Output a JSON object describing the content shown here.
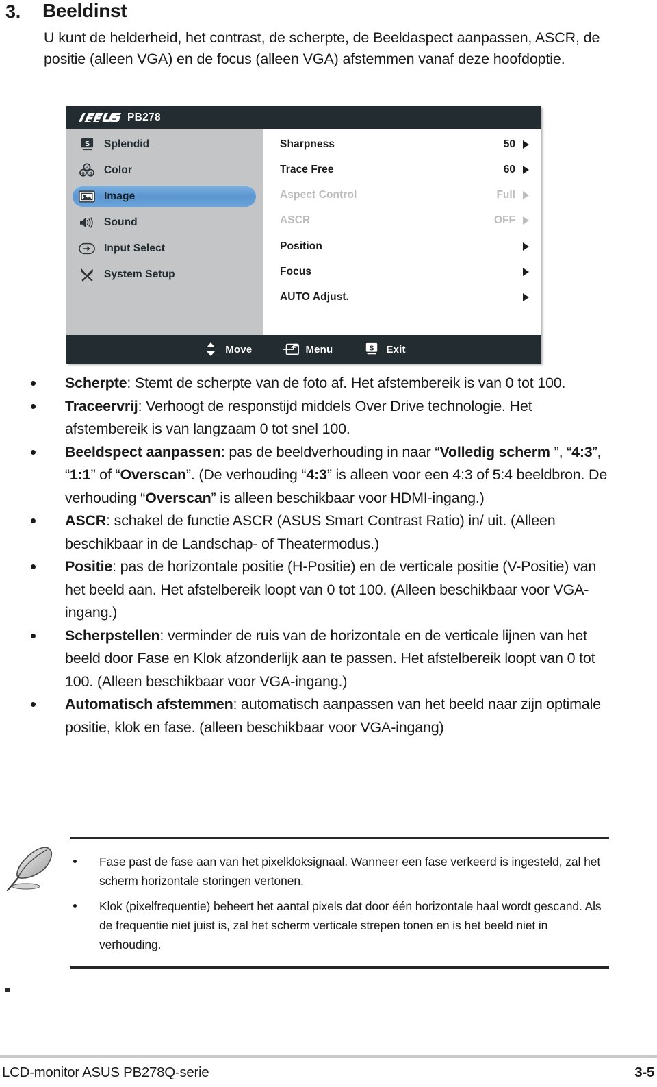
{
  "section": {
    "number": "3.",
    "title": "Beeldinst",
    "intro": "U kunt de helderheid, het contrast, de scherpte, de Beeldaspect aanpassen, ASCR, de positie (alleen VGA) en de focus (alleen VGA) afstemmen vanaf deze hoofdoptie."
  },
  "osd": {
    "brand": "ASUS",
    "model": "PB278",
    "accent_selected": "#5c96d0",
    "titlebar_color": "#232c31",
    "sidebar_color": "#c3c5c7",
    "sidebar": [
      {
        "label": "Splendid",
        "icon": "splendid-icon",
        "selected": false
      },
      {
        "label": "Color",
        "icon": "color-palette-icon",
        "selected": false
      },
      {
        "label": "Image",
        "icon": "image-icon",
        "selected": true
      },
      {
        "label": "Sound",
        "icon": "speaker-icon",
        "selected": false
      },
      {
        "label": "Input Select",
        "icon": "input-arrow-icon",
        "selected": false
      },
      {
        "label": "System Setup",
        "icon": "tools-icon",
        "selected": false
      }
    ],
    "items": [
      {
        "label": "Sharpness",
        "value": "50",
        "arrow": true,
        "disabled": false
      },
      {
        "label": "Trace Free",
        "value": "60",
        "arrow": true,
        "disabled": false
      },
      {
        "label": "Aspect Control",
        "value": "Full",
        "arrow": true,
        "disabled": true
      },
      {
        "label": "ASCR",
        "value": "OFF",
        "arrow": true,
        "disabled": true
      },
      {
        "label": "Position",
        "value": "",
        "arrow": true,
        "disabled": false
      },
      {
        "label": "Focus",
        "value": "",
        "arrow": true,
        "disabled": false
      },
      {
        "label": "AUTO Adjust.",
        "value": "",
        "arrow": true,
        "disabled": false
      }
    ],
    "footer": [
      {
        "label": "Move",
        "icon": "up-down-arrows-icon"
      },
      {
        "label": "Menu",
        "icon": "menu-enter-icon"
      },
      {
        "label": "Exit",
        "icon": "splendid-s-icon"
      }
    ]
  },
  "bullets": [
    {
      "term": "Scherpte",
      "rest": ": Stemt de scherpte van de foto af. Het afstembereik is van 0 tot 100."
    },
    {
      "term": "Traceervrij",
      "rest": ": Verhoogt de responstijd middels Over Drive technologie. Het afstembereik is van langzaam 0 tot snel 100."
    },
    {
      "term": "Beeldspect aanpassen",
      "rest": ": pas de beeldverhouding in naar “Volledig scherm ”, “4:3”, “1:1” of “Overscan”. (De verhouding “4:3” is alleen voor een 4:3 of 5:4 beeldbron. De verhouding “Overscan” is alleen beschikbaar voor HDMI-ingang.)",
      "inline_bold": [
        "Volledig scherm ",
        "4:3",
        "1:1",
        "Overscan",
        "4:3",
        "Overscan"
      ]
    },
    {
      "term": "ASCR",
      "rest": ": schakel de functie ASCR (ASUS Smart Contrast Ratio) in/ uit. (Alleen beschikbaar in de Landschap- of Theatermodus.)"
    },
    {
      "term": "Positie",
      "rest": ": pas de horizontale positie (H-Positie) en de verticale positie (V-Positie) van het beeld aan. Het afstelbereik loopt van 0 tot 100. (Alleen beschikbaar voor VGA-ingang.)"
    },
    {
      "term": "Scherpstellen",
      "rest": ": verminder de ruis van de horizontale en de verticale lijnen van het beeld door Fase en Klok afzonderlijk aan te passen. Het afstelbereik loopt van 0 tot 100. (Alleen beschikbaar voor VGA-ingang.)"
    },
    {
      "term": "Automatisch afstemmen",
      "rest": ": automatisch aanpassen van het beeld naar zijn optimale positie, klok en fase. (alleen beschikbaar voor VGA-ingang)"
    }
  ],
  "note": {
    "icon": "quill-pen-icon",
    "items": [
      "Fase past de fase aan van het pixelkloksignaal. Wanneer een fase verkeerd is ingesteld, zal het scherm horizontale storingen vertonen.",
      "Klok (pixelfrequentie) beheert het aantal pixels dat door één horizontale haal wordt gescand. Als de frequentie niet juist is, zal het scherm verticale strepen tonen en is het beeld niet in verhouding."
    ]
  },
  "page_footer": {
    "left": "LCD-monitor ASUS PB278Q-serie",
    "right": "3-5"
  }
}
